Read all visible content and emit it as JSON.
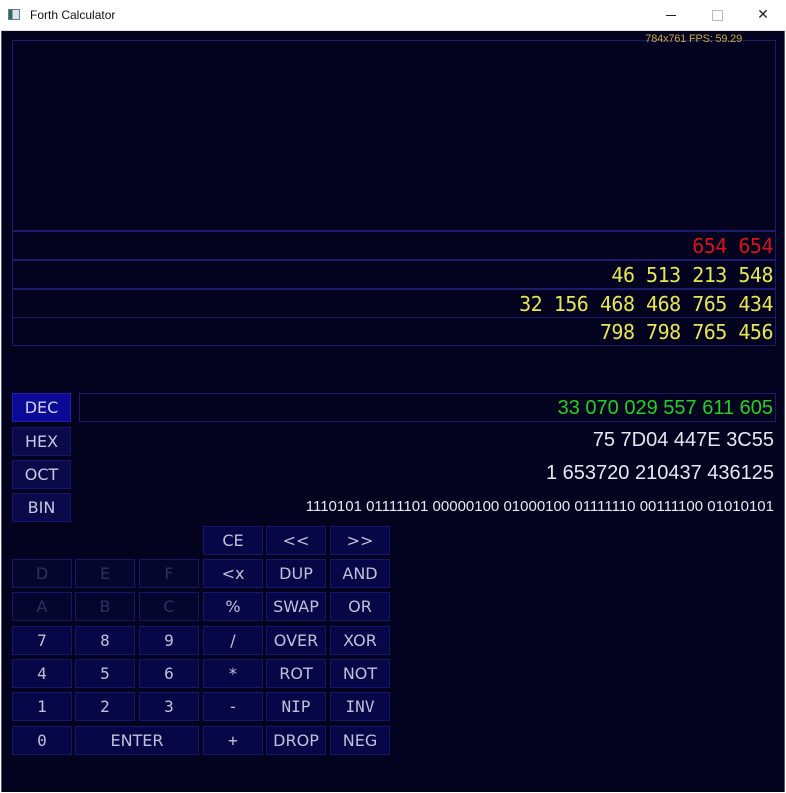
{
  "window": {
    "title": "Forth Calculator",
    "minimize_label": "minimize",
    "maximize_label": "maximize",
    "close_label": "close"
  },
  "status": {
    "fps_text": "784x761 FPS: 59.29",
    "color": "#c7a93a"
  },
  "stack": {
    "rows": [
      {
        "text": "654 654",
        "color": "#d8121c"
      },
      {
        "text": "46 513 213 548",
        "color": "#e6e650"
      },
      {
        "text": "32 156 468 468 765 434",
        "color": "#e6e650"
      },
      {
        "text": "798 798 765 456",
        "color": "#e6e650"
      }
    ]
  },
  "modes": [
    {
      "label": "DEC",
      "active": true
    },
    {
      "label": "HEX",
      "active": false
    },
    {
      "label": "OCT",
      "active": false
    },
    {
      "label": "BIN",
      "active": false
    }
  ],
  "display": {
    "dec": "33 070 029 557 611 605",
    "hex": "75 7D04 447E 3C55",
    "oct": "1 653720 210437 436125",
    "bin": "1110101 01111101 00000100 01000100 01111110 00111100 01010101",
    "dec_color": "#1fd31f"
  },
  "keypad": {
    "row0": [
      "CE",
      "<<",
      ">>"
    ],
    "row1": [
      "D",
      "E",
      "F",
      "<x",
      "DUP",
      "AND"
    ],
    "row2": [
      "A",
      "B",
      "C",
      "%",
      "SWAP",
      "OR"
    ],
    "row3": [
      "7",
      "8",
      "9",
      "/",
      "OVER",
      "XOR"
    ],
    "row4": [
      "4",
      "5",
      "6",
      "*",
      "ROT",
      "NOT"
    ],
    "row5": [
      "1",
      "2",
      "3",
      "-",
      "NIP",
      "INV"
    ],
    "row6": [
      "0",
      "ENTER",
      "+",
      "DROP",
      "NEG"
    ],
    "disabled_keys": [
      "D",
      "E",
      "F",
      "A",
      "B",
      "C"
    ]
  }
}
